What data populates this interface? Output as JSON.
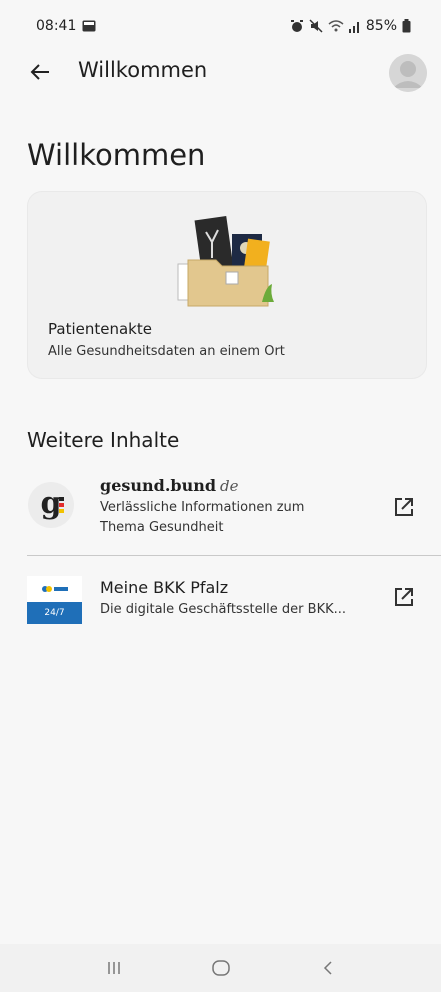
{
  "status": {
    "time": "08:41",
    "battery": "85%"
  },
  "app_bar": {
    "title": "Willkommen"
  },
  "page": {
    "title": "Willkommen"
  },
  "card": {
    "title": "Patientenakte",
    "subtitle": "Alle Gesundheitsdaten an einem Ort"
  },
  "section": {
    "title": "Weitere Inhalte"
  },
  "items": [
    {
      "brand": "gesund.bund",
      "brand_suffix": "de",
      "description": "Verlässliche Informationen zum Thema Gesundheit",
      "icon": "external-link-icon"
    },
    {
      "title": "Meine BKK Pfalz",
      "description": "Die digitale Geschäftsstelle der BKK...",
      "logo_text": "24/7",
      "icon": "external-link-icon"
    }
  ],
  "colors": {
    "background": "#f7f7f7",
    "bkk_blue": "#1f6fb8",
    "divider": "#c9c9c9"
  }
}
